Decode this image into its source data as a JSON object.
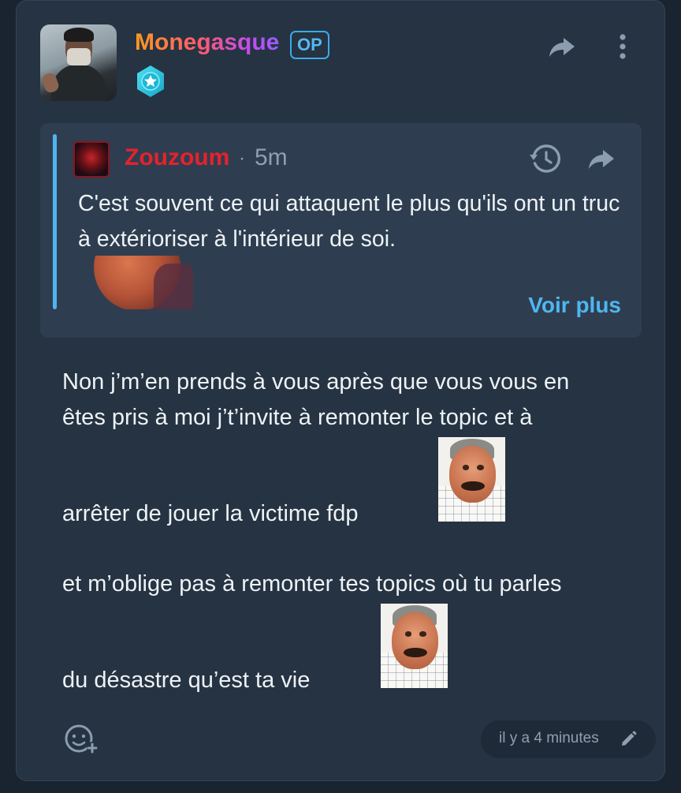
{
  "post": {
    "author": "Monegasque",
    "op_label": "OP",
    "rank_icon": "star-badge-icon",
    "share_icon": "share-icon",
    "more_icon": "more-vertical-icon"
  },
  "quote": {
    "author": "Zouzoum",
    "separator": "·",
    "time": "5m",
    "text": "C'est souvent ce qui attaquent le plus qu'ils ont un truc à extérioriser à l'intérieur de soi.",
    "more_label": "Voir plus",
    "history_icon": "history-icon",
    "share_icon": "share-icon"
  },
  "message": {
    "lines": [
      "Non j’m’en prends à vous après que vous vous en",
      "êtes pris à moi j’t’invite à remonter le topic et à",
      "arrêter de jouer la victime fdp",
      "et m’oblige pas à remonter tes topics où tu parles",
      "du désastre qu’est ta vie"
    ]
  },
  "footer": {
    "reaction_icon": "add-reaction-icon",
    "edited_label": "il y a 4 minutes",
    "edit_icon": "pencil-icon"
  },
  "colors": {
    "background": "#1a2430",
    "card": "#253342",
    "quote_bg": "#2e3e50",
    "accent": "#4fb4ee",
    "quote_author": "#e5222d",
    "muted": "#8f9fb0"
  }
}
